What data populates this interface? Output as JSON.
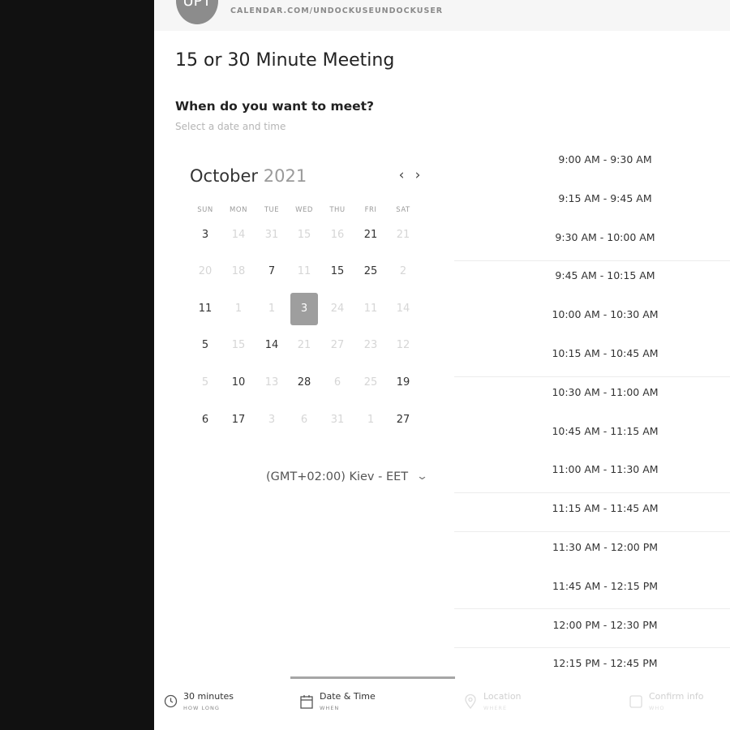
{
  "header": {
    "avatar_initials": "UPT",
    "url": "CALENDAR.COM/UNDOCKUSEUNDOCKUSER"
  },
  "event": {
    "title": "15 or 30 Minute Meeting",
    "question": "When do you want to meet?",
    "instruction": "Select a date and time"
  },
  "calendar": {
    "month": "October",
    "year": "2021",
    "prev_icon": "chevron-left-icon",
    "next_icon": "chevron-right-icon",
    "weekdays": [
      "SUN",
      "MON",
      "TUE",
      "WED",
      "THU",
      "FRI",
      "SAT"
    ],
    "weeks": [
      [
        {
          "d": "3",
          "s": "a"
        },
        {
          "d": "14",
          "s": "d"
        },
        {
          "d": "31",
          "s": "d"
        },
        {
          "d": "15",
          "s": "d"
        },
        {
          "d": "16",
          "s": "d"
        },
        {
          "d": "21",
          "s": "a"
        },
        {
          "d": "21",
          "s": "d"
        }
      ],
      [
        {
          "d": "20",
          "s": "d"
        },
        {
          "d": "18",
          "s": "d"
        },
        {
          "d": "7",
          "s": "a"
        },
        {
          "d": "11",
          "s": "d"
        },
        {
          "d": "15",
          "s": "a"
        },
        {
          "d": "25",
          "s": "a"
        },
        {
          "d": "2",
          "s": "d"
        }
      ],
      [
        {
          "d": "11",
          "s": "a"
        },
        {
          "d": "1",
          "s": "d"
        },
        {
          "d": "1",
          "s": "d"
        },
        {
          "d": "3",
          "s": "sel"
        },
        {
          "d": "24",
          "s": "d"
        },
        {
          "d": "11",
          "s": "d"
        },
        {
          "d": "14",
          "s": "d"
        }
      ],
      [
        {
          "d": "5",
          "s": "a"
        },
        {
          "d": "15",
          "s": "d"
        },
        {
          "d": "14",
          "s": "a"
        },
        {
          "d": "21",
          "s": "d"
        },
        {
          "d": "27",
          "s": "d"
        },
        {
          "d": "23",
          "s": "d"
        },
        {
          "d": "12",
          "s": "d"
        }
      ],
      [
        {
          "d": "5",
          "s": "d"
        },
        {
          "d": "10",
          "s": "a"
        },
        {
          "d": "13",
          "s": "d"
        },
        {
          "d": "28",
          "s": "a"
        },
        {
          "d": "6",
          "s": "d"
        },
        {
          "d": "25",
          "s": "d"
        },
        {
          "d": "19",
          "s": "a"
        }
      ],
      [
        {
          "d": "6",
          "s": "a"
        },
        {
          "d": "17",
          "s": "a"
        },
        {
          "d": "3",
          "s": "d"
        },
        {
          "d": "6",
          "s": "d"
        },
        {
          "d": "31",
          "s": "d"
        },
        {
          "d": "1",
          "s": "d"
        },
        {
          "d": "27",
          "s": "a"
        }
      ]
    ]
  },
  "timezone": {
    "label": "(GMT+02:00) Kiev - EET",
    "icon": "chevron-down-icon"
  },
  "time_slots": [
    "9:00 AM - 9:30 AM",
    "9:15 AM - 9:45 AM",
    "9:30 AM - 10:00 AM",
    "9:45 AM - 10:15 AM",
    "10:00 AM - 10:30 AM",
    "10:15 AM - 10:45 AM",
    "10:30 AM - 11:00 AM",
    "10:45 AM - 11:15 AM",
    "11:00 AM - 11:30 AM",
    "11:15 AM - 11:45 AM",
    "11:30 AM - 12:00 PM",
    "11:45 AM - 12:15 PM",
    "12:00 PM - 12:30 PM",
    "12:15 PM - 12:45 PM"
  ],
  "steps": [
    {
      "label": "30 minutes",
      "sub": "HOW LONG",
      "icon": "clock-icon",
      "active": false,
      "done": true
    },
    {
      "label": "Date & Time",
      "sub": "WHEN",
      "icon": "calendar-icon",
      "active": true,
      "done": false
    },
    {
      "label": "Location",
      "sub": "WHERE",
      "icon": "map-pin-icon",
      "active": false,
      "done": false
    },
    {
      "label": "Confirm info",
      "sub": "WHO",
      "icon": "checkbox-icon",
      "active": false,
      "done": false
    }
  ],
  "colors": {
    "selected_day": "#9e9e9e",
    "active_tab_bar": "#a6a6a6",
    "background": "#111111"
  }
}
